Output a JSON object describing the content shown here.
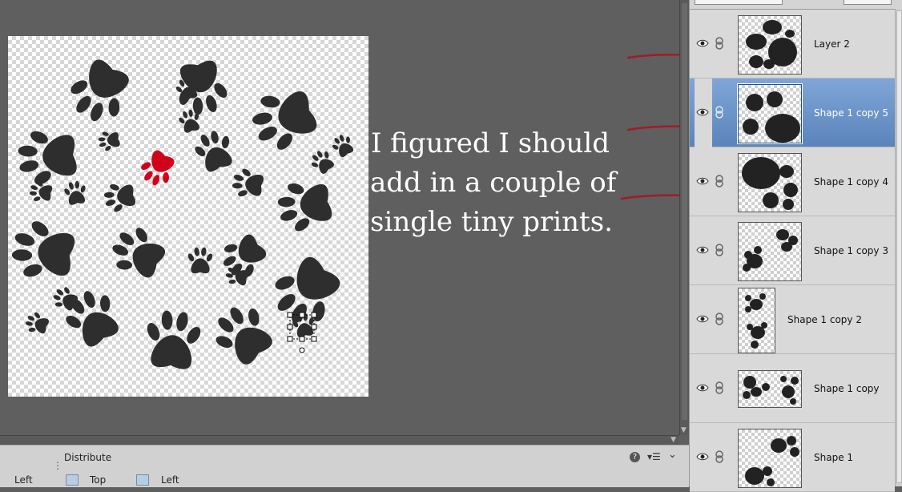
{
  "annotation": {
    "lines": [
      "I figured I should",
      "add in a couple of",
      "single tiny prints."
    ],
    "arrow_color": "#a31a2b"
  },
  "options_bar": {
    "left_label": "Left",
    "distribute_label": "Distribute",
    "top_label": "Top",
    "left2_label": "Left",
    "help_icon": "?"
  },
  "layers_panel": {
    "items": [
      {
        "name": "Layer 2",
        "selected": false
      },
      {
        "name": "Shape 1 copy 5",
        "selected": true
      },
      {
        "name": "Shape 1 copy 4",
        "selected": false
      },
      {
        "name": "Shape 1 copy 3",
        "selected": false
      },
      {
        "name": "Shape 1 copy 2",
        "selected": false
      },
      {
        "name": "Shape 1 copy",
        "selected": false
      },
      {
        "name": "Shape 1",
        "selected": false
      }
    ]
  },
  "colors": {
    "paw_dark": "#2e2e2e",
    "paw_accent": "#d0021b",
    "selection_blue": "#5a84bc",
    "workspace": "#5f5f5f"
  }
}
